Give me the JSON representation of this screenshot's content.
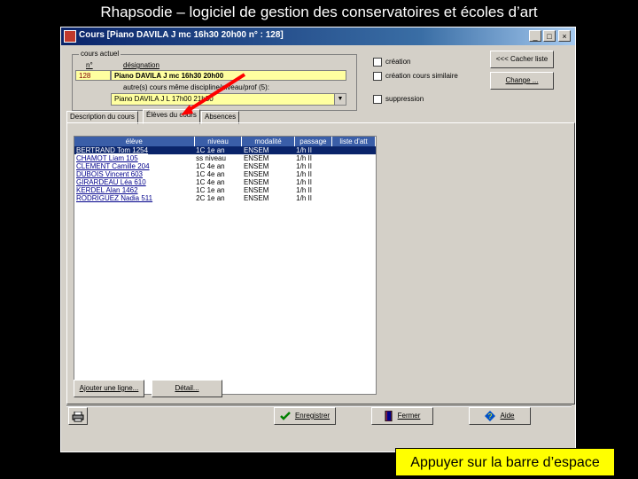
{
  "slide": {
    "title": "Rhapsodie – logiciel de gestion des conservatoires et écoles d’art",
    "banner": "Appuyer sur la barre d’espace"
  },
  "window": {
    "title": "Cours [Piano DAVILA J mc 16h30 20h00   n° : 128]",
    "controls": [
      "_",
      "□",
      "×"
    ]
  },
  "course_group": {
    "legend": "cours actuel",
    "no_label": "n°",
    "desc_label": "désignation",
    "no_value": "128",
    "desc_value": "Piano DAVILA J mc 16h30 20h00",
    "other_label": "autre(s) cours même discipline/niveau/prof (5):",
    "other_value": "Piano DAVILA J L 17h00 21h30"
  },
  "options": {
    "creation": "création",
    "creation_similaire": "création cours similaire",
    "suppression": "suppression"
  },
  "side_buttons": {
    "hide": "<<< Cacher liste",
    "change": "Change ..."
  },
  "tabs": [
    "Description du cours",
    "Élèves du cours",
    "Absences"
  ],
  "grid": {
    "headers": [
      "élève",
      "niveau",
      "modalité",
      "passage",
      "liste d'att"
    ],
    "rows": [
      [
        "BERTRAND Tom 1254",
        "1C 1e an",
        "ENSEM",
        "1/h II",
        ""
      ],
      [
        "CHAMOT Liam 105",
        "ss niveau",
        "ENSEM",
        "1/h II",
        ""
      ],
      [
        "CLEMENT Camille 204",
        "1C 4e an",
        "ENSEM",
        "1/h II",
        ""
      ],
      [
        "DUBOIS Vincent 603",
        "1C 4e an",
        "ENSEM",
        "1/h II",
        ""
      ],
      [
        "GIRARDEAU Léa 610",
        "1C 4e an",
        "ENSEM",
        "1/h II",
        ""
      ],
      [
        "KERDEL Alan 1462",
        "1C 1e an",
        "ENSEM",
        "1/h II",
        ""
      ],
      [
        "RODRIGUEZ Nadia 511",
        "2C 1e an",
        "ENSEM",
        "1/h II",
        ""
      ]
    ]
  },
  "bottom_buttons": {
    "add": "Ajouter une ligne...",
    "detail": "Détail..."
  },
  "footer_buttons": {
    "save": "Enregistrer",
    "close": "Fermer",
    "help": "Aide"
  }
}
